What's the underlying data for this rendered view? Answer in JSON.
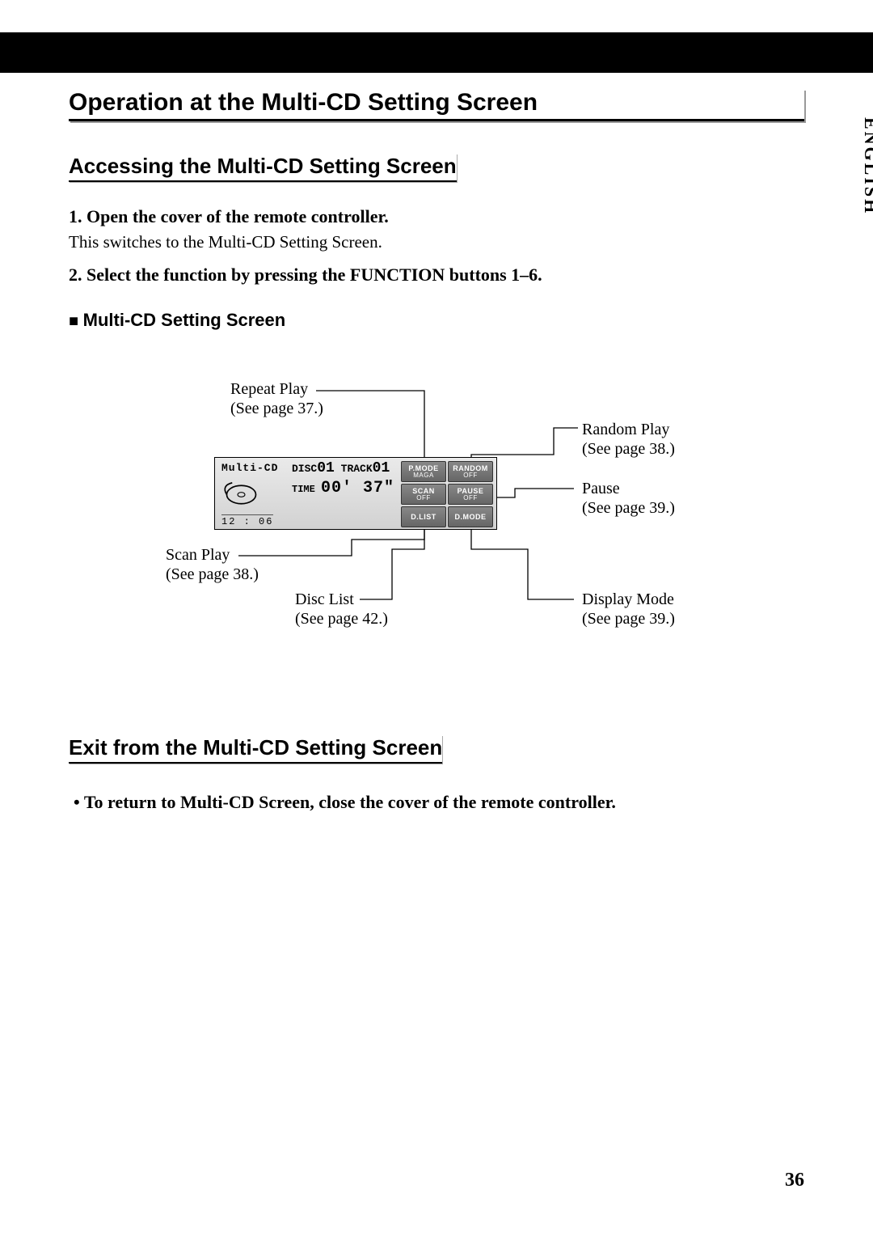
{
  "language_tab": "ENGLISH",
  "page_number": "36",
  "h1": "Operation at the Multi-CD Setting Screen",
  "accessing": {
    "heading": "Accessing the Multi-CD Setting Screen",
    "step1_head": "1.  Open the cover of the remote controller.",
    "step1_sub": "This switches to the Multi-CD Setting Screen.",
    "step2_head": "2.  Select the function by pressing the FUNCTION buttons 1–6."
  },
  "diagram": {
    "subhead": "Multi-CD Setting Screen",
    "lcd": {
      "source": "Multi-CD",
      "disc_label": "DISC",
      "disc_num": "01",
      "track_label": "TRACK",
      "track_num": "01",
      "time_label": "TIME",
      "time_value": "00' 37\"",
      "clock": "12 : 06"
    },
    "buttons": {
      "pmode_top": "P.MODE",
      "pmode_sub": "MAGA",
      "random_top": "RANDOM",
      "random_sub": "OFF",
      "scan_top": "SCAN",
      "scan_sub": "OFF",
      "pause_top": "PAUSE",
      "pause_sub": "OFF",
      "dlist": "D.LIST",
      "dmode": "D.MODE"
    },
    "callouts": {
      "repeat_name": "Repeat Play",
      "repeat_ref": "(See page 37.)",
      "random_name": "Random Play",
      "random_ref": "(See page 38.)",
      "pause_name": "Pause",
      "pause_ref": "(See page 39.)",
      "scan_name": "Scan Play",
      "scan_ref": "(See page 38.)",
      "disclist_name": "Disc List",
      "disclist_ref": "(See page 42.)",
      "dispmode_name": "Display Mode",
      "dispmode_ref": "(See page 39.)"
    }
  },
  "exit": {
    "heading": "Exit from the Multi-CD Setting Screen",
    "bullet": "To return to Multi-CD Screen, close the cover of the remote controller."
  }
}
